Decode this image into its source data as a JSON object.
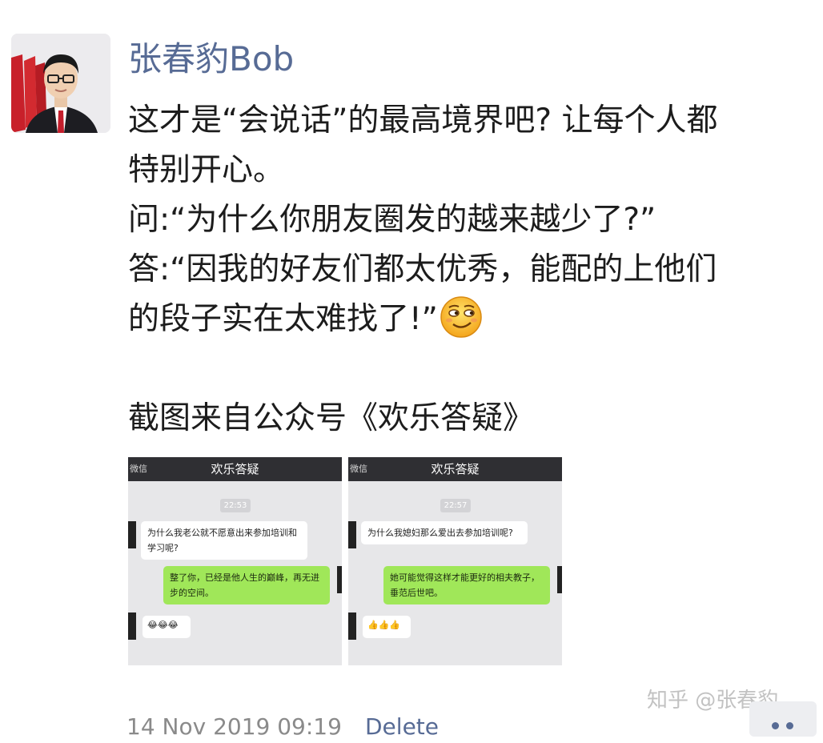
{
  "post": {
    "author": "张春豹Bob",
    "text_lines": [
      "这才是“会说话”的最高境界吧? 让每个人都",
      "特别开心。",
      "问:“为什么你朋友圈发的越来越少了?”",
      "答:“因我的好友们都太优秀，能配的上他们",
      "的段子实在太难找了!”"
    ],
    "source_line": "截图来自公众号《欢乐答疑》",
    "emoji_icon": "smirk-emoji-icon"
  },
  "images": [
    {
      "app_back": "微信",
      "chat_title": "欢乐答疑",
      "time": "22:53",
      "question": "为什么我老公就不愿意出来参加培训和学习呢?",
      "answer": "整了你，已经是他人生的巅峰，再无进步的空间。",
      "reactions": "😂😂😂"
    },
    {
      "app_back": "微信",
      "chat_title": "欢乐答疑",
      "time": "22:57",
      "question": "为什么我媳妇那么爱出去参加培训呢?",
      "answer": "她可能觉得这样才能更好的相夫教子，垂范后世吧。",
      "reactions": "👍👍👍"
    }
  ],
  "footer": {
    "timestamp": "14 Nov 2019 09:19",
    "delete_label": "Delete",
    "watermark": "知乎 @张春豹",
    "more_icon": "more-dots-icon"
  },
  "colors": {
    "link_blue": "#576b95",
    "wechat_green": "#a0e759",
    "chat_bg": "#e7e7e9"
  }
}
